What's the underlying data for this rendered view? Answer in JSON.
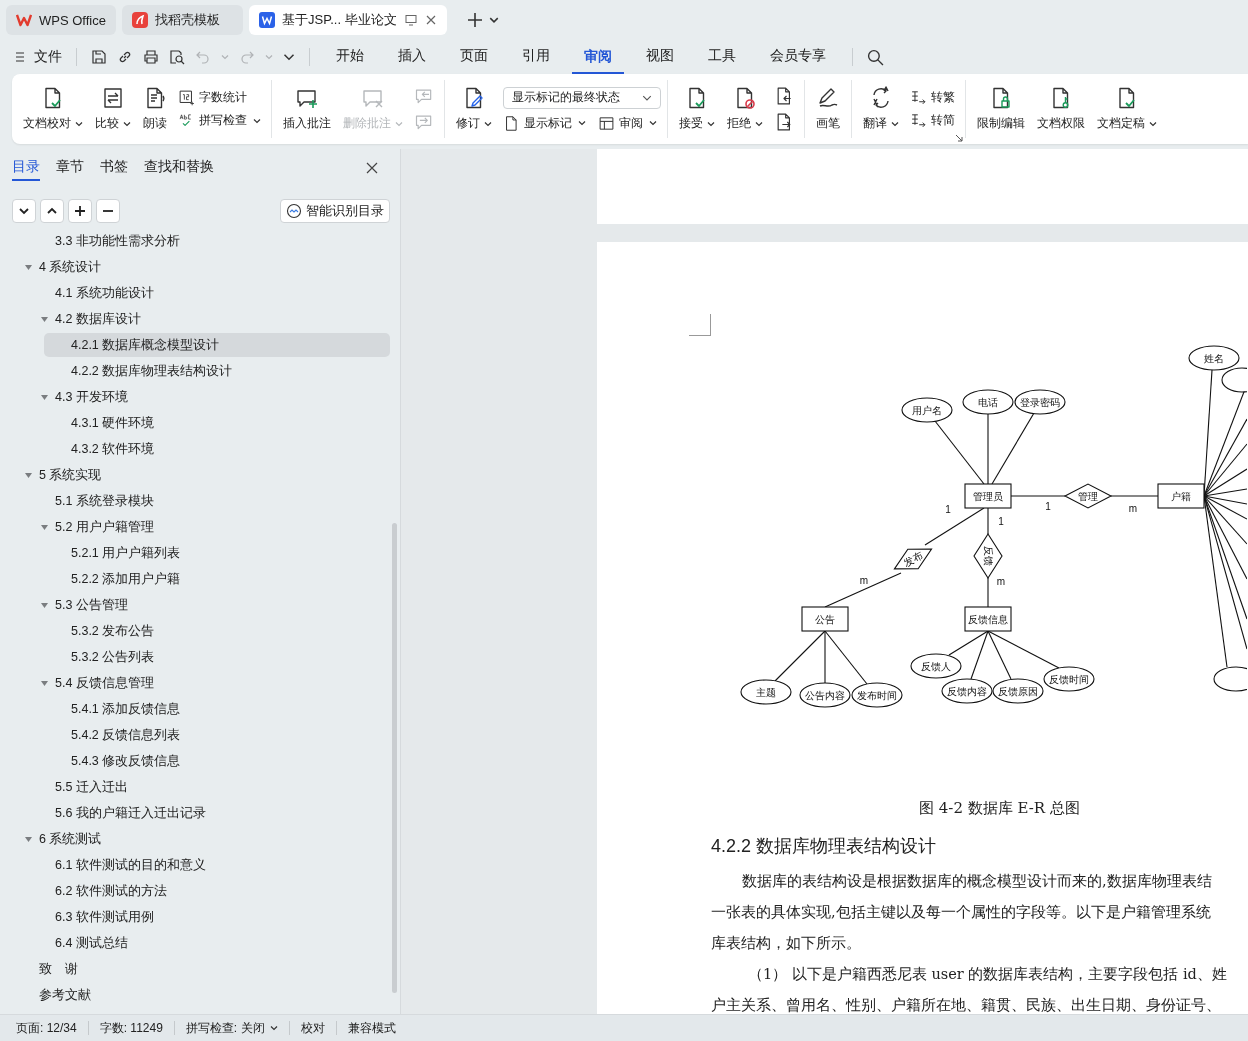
{
  "title_tabs": [
    {
      "label": "WPS Office",
      "selected": false
    },
    {
      "label": "找稻壳模板",
      "selected": false
    },
    {
      "label": "基于JSP... 毕业论文",
      "selected": true
    }
  ],
  "menu": {
    "file": "文件",
    "tabs": [
      {
        "label": "开始",
        "selected": false
      },
      {
        "label": "插入",
        "selected": false
      },
      {
        "label": "页面",
        "selected": false
      },
      {
        "label": "引用",
        "selected": false
      },
      {
        "label": "审阅",
        "selected": true
      },
      {
        "label": "视图",
        "selected": false
      },
      {
        "label": "工具",
        "selected": false
      },
      {
        "label": "会员专享",
        "selected": false
      }
    ]
  },
  "ribbon": {
    "groups": [
      {
        "items": [
          {
            "kind": "large",
            "label": "文档校对",
            "dropdown": true,
            "disabled": false
          },
          {
            "kind": "large",
            "label": "比较",
            "dropdown": true,
            "disabled": false
          },
          {
            "kind": "large",
            "label": "朗读",
            "dropdown": false,
            "disabled": false
          },
          {
            "kind": "stack",
            "items": [
              {
                "label": "字数统计",
                "dropdown": false,
                "disabled": false
              },
              {
                "label": "拼写检查",
                "dropdown": true,
                "disabled": false
              }
            ]
          }
        ]
      },
      {
        "items": [
          {
            "kind": "large",
            "label": "插入批注",
            "dropdown": false,
            "disabled": false
          },
          {
            "kind": "large",
            "label": "删除批注",
            "dropdown": true,
            "disabled": true
          },
          {
            "kind": "stack",
            "items": [
              {
                "disabled": true
              },
              {
                "disabled": true
              }
            ]
          }
        ]
      },
      {
        "items": [
          {
            "kind": "large",
            "label": "修订",
            "dropdown": true,
            "disabled": false
          },
          {
            "kind": "review",
            "select": "显示标记的最终状态",
            "buttons": [
              {
                "label": "显示标记",
                "dropdown": true
              },
              {
                "label": "审阅",
                "dropdown": true
              }
            ]
          }
        ]
      },
      {
        "items": [
          {
            "kind": "large",
            "label": "接受",
            "dropdown": true,
            "disabled": false
          },
          {
            "kind": "large",
            "label": "拒绝",
            "dropdown": true,
            "disabled": false
          },
          {
            "kind": "stack",
            "items": [
              {
                "disabled": false
              },
              {
                "disabled": false
              }
            ]
          }
        ]
      },
      {
        "items": [
          {
            "kind": "large",
            "label": "画笔",
            "dropdown": false,
            "disabled": false
          }
        ]
      },
      {
        "items": [
          {
            "kind": "large",
            "label": "翻译",
            "dropdown": true,
            "disabled": false
          },
          {
            "kind": "stack",
            "items": [
              {
                "label": "转繁",
                "dropdown": false,
                "disabled": false
              },
              {
                "label": "转简",
                "dropdown": false,
                "disabled": false
              }
            ]
          }
        ]
      },
      {
        "items": [
          {
            "kind": "large",
            "label": "限制编辑",
            "dropdown": false,
            "disabled": false
          },
          {
            "kind": "large",
            "label": "文档权限",
            "dropdown": false,
            "disabled": false
          },
          {
            "kind": "large",
            "label": "文档定稿",
            "dropdown": true,
            "disabled": false
          }
        ]
      }
    ]
  },
  "sidebar": {
    "tabs": [
      {
        "label": "目录",
        "selected": true
      },
      {
        "label": "章节",
        "selected": false
      },
      {
        "label": "书签",
        "selected": false
      },
      {
        "label": "查找和替换",
        "selected": false
      }
    ],
    "smart_button": "智能识别目录",
    "outline": [
      {
        "children": [
          {
            "label": "3.3 非功能性需求分析",
            "selected": false
          }
        ]
      },
      {
        "label": "4  系统设计",
        "selected": false,
        "expanded": true,
        "children": [
          {
            "label": "4.1 系统功能设计",
            "selected": false
          },
          {
            "label": "4.2 数据库设计",
            "selected": false,
            "expanded": true,
            "children": [
              {
                "label": "4.2.1 数据库概念模型设计",
                "selected": true
              },
              {
                "label": "4.2.2 数据库物理表结构设计",
                "selected": false
              }
            ]
          },
          {
            "label": "4.3 开发环境",
            "selected": false,
            "expanded": true,
            "children": [
              {
                "label": "4.3.1  硬件环境",
                "selected": false
              },
              {
                "label": "4.3.2  软件环境",
                "selected": false
              }
            ]
          }
        ]
      },
      {
        "label": "5  系统实现",
        "selected": false,
        "expanded": true,
        "children": [
          {
            "label": "5.1  系统登录模块",
            "selected": false
          },
          {
            "label": "5.2  用户户籍管理",
            "selected": false,
            "expanded": true,
            "children": [
              {
                "label": "5.2.1  用户户籍列表",
                "selected": false
              },
              {
                "label": "5.2.2  添加用户户籍",
                "selected": false
              }
            ]
          },
          {
            "label": "5.3  公告管理",
            "selected": false,
            "expanded": true,
            "children": [
              {
                "label": "5.3.2  发布公告",
                "selected": false
              },
              {
                "label": "5.3.2  公告列表",
                "selected": false
              }
            ]
          },
          {
            "label": "5.4  反馈信息管理",
            "selected": false,
            "expanded": true,
            "children": [
              {
                "label": "5.4.1  添加反馈信息",
                "selected": false
              },
              {
                "label": "5.4.2  反馈信息列表",
                "selected": false
              },
              {
                "label": "5.4.3  修改反馈信息",
                "selected": false
              }
            ]
          },
          {
            "label": "5.5  迁入迁出",
            "selected": false
          },
          {
            "label": "5.6  我的户籍迁入迁出记录",
            "selected": false
          }
        ]
      },
      {
        "label": "6  系统测试",
        "selected": false,
        "expanded": true,
        "children": [
          {
            "label": "6.1 软件测试的目的和意义",
            "selected": false
          },
          {
            "label": "6.2 软件测试的方法",
            "selected": false
          },
          {
            "label": "6.3  软件测试用例",
            "selected": false
          },
          {
            "label": "6.4 测试总结",
            "selected": false
          }
        ]
      },
      {
        "label": "致　谢",
        "selected": false
      },
      {
        "label": "参考文献",
        "selected": false
      }
    ]
  },
  "document": {
    "er_diagram": {
      "entities": [
        "管理员",
        "户籍",
        "公告",
        "反馈信息"
      ],
      "relations": [
        "管理",
        "发布",
        "反馈"
      ],
      "attributes": [
        "用户名",
        "电话",
        "登录密码",
        "姓名",
        "主题",
        "公告内容",
        "发布时间",
        "反馈人",
        "反馈内容",
        "反馈原因",
        "反馈时间"
      ],
      "cardinalities": [
        "1",
        "1",
        "1",
        "m",
        "m",
        "m"
      ]
    },
    "caption": "图 4-2 数据库 E-R 总图",
    "heading": "4.2.2 数据库物理表结构设计",
    "lines": [
      {
        "kind": "first",
        "text": "数据库的表结构设是根据数据库的概念模型设计而来的,数据库物理表结"
      },
      {
        "kind": "plain",
        "text": "一张表的具体实现,包括主键以及每一个属性的字段等。以下是户籍管理系统"
      },
      {
        "kind": "plain",
        "text": "库表结构，如下所示。"
      },
      {
        "kind": "item",
        "text": "（1） 以下是户籍西悉尼表 user 的数据库表结构，主要字段包括 id、姓"
      },
      {
        "kind": "plain",
        "text": "户主关系、曾用名、性别、户籍所在地、籍贯、民族、出生日期、身份证号、"
      }
    ]
  },
  "status_bar": {
    "page": "页面: 12/34",
    "words": "字数: 11249",
    "spell": "拼写检查: 关闭",
    "proof": "校对",
    "mode": "兼容模式"
  }
}
